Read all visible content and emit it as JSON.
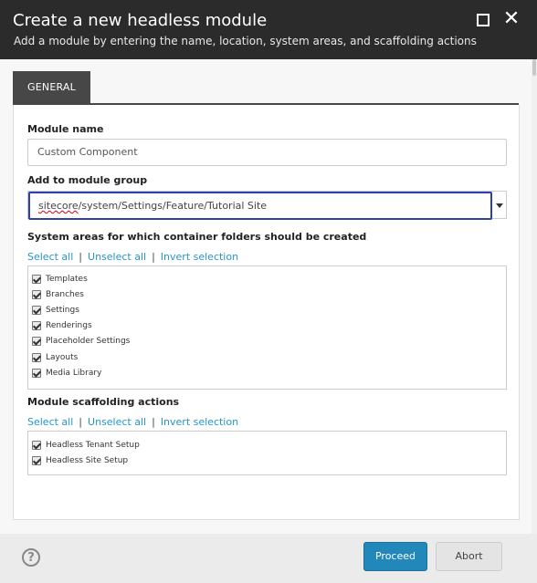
{
  "dialog": {
    "title": "Create a new headless module",
    "subtitle": "Add a module by entering the name, location, system areas, and scaffolding actions",
    "maximize_icon": "maximize-icon",
    "close_icon": "close-icon",
    "close_glyph": "✕"
  },
  "tabs": [
    {
      "label": "GENERAL",
      "active": true
    }
  ],
  "form": {
    "module_name_label": "Module name",
    "module_name_value": "Custom Component",
    "module_group_label": "Add to module group",
    "module_group_value_prefix": "sitecore",
    "module_group_value_rest": "/system/Settings/Feature/Tutorial Site",
    "system_areas_label": "System areas for which container folders should be created",
    "system_areas_links": {
      "select_all": "Select all",
      "sep": "|",
      "unselect_all": "Unselect all",
      "invert": "Invert selection"
    },
    "system_areas": [
      {
        "label": "Templates",
        "checked": true
      },
      {
        "label": "Branches",
        "checked": true
      },
      {
        "label": "Settings",
        "checked": true
      },
      {
        "label": "Renderings",
        "checked": true
      },
      {
        "label": "Placeholder Settings",
        "checked": true
      },
      {
        "label": "Layouts",
        "checked": true
      },
      {
        "label": "Media Library",
        "checked": true
      }
    ],
    "scaffolding_label": "Module scaffolding actions",
    "scaffolding_links": {
      "select_all": "Select all",
      "sep": "|",
      "unselect_all": "Unselect all",
      "invert": "Invert selection"
    },
    "scaffolding_actions": [
      {
        "label": "Headless Tenant Setup",
        "checked": true
      },
      {
        "label": "Headless Site Setup",
        "checked": true
      }
    ]
  },
  "footer": {
    "help_glyph": "?",
    "proceed_label": "Proceed",
    "abort_label": "Abort",
    "primary_color": "#2287b9"
  }
}
